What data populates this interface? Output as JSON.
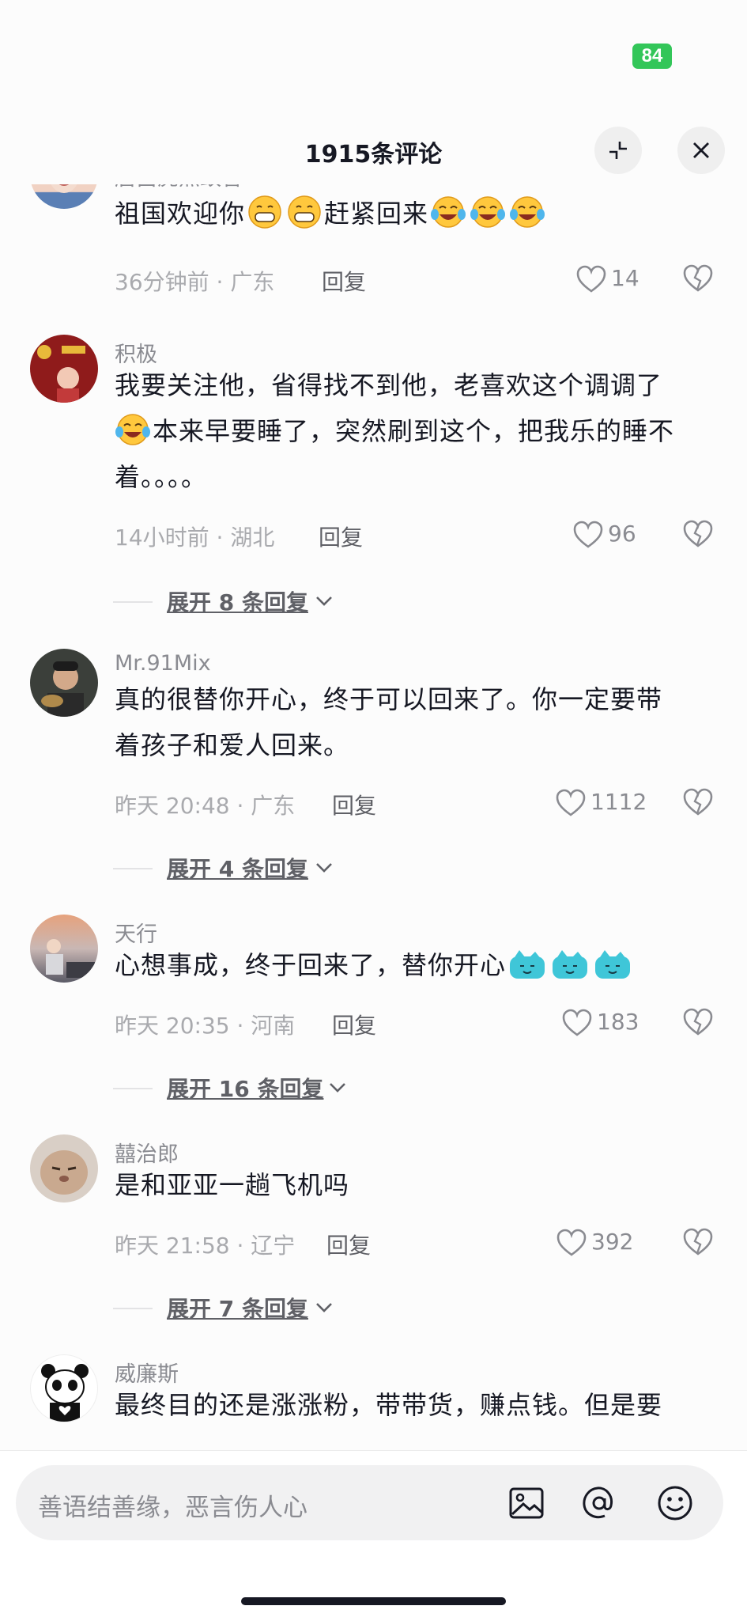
{
  "status_bar": {
    "battery": "84"
  },
  "header": {
    "title": "1915条评论"
  },
  "comments": [
    {
      "username": "唐吕虎点蚊香",
      "text_parts": [
        "祖国欢迎你",
        "赶紧回来"
      ],
      "time_location": "36分钟前 · 广东",
      "reply_label": "回复",
      "likes": "14",
      "expand_label": ""
    },
    {
      "username": "积极",
      "text_line1": "我要关注他，省得找不到他，老喜欢这个调调了",
      "text_line2": "本来早要睡了，突然刷到这个，把我乐的睡不",
      "text_line3": "着。。。。",
      "time_location": "14小时前 · 湖北",
      "reply_label": "回复",
      "likes": "96",
      "expand_label": "展开 8 条回复"
    },
    {
      "username": "Mr.91Mix",
      "text_line1": "真的很替你开心，终于可以回来了。你一定要带",
      "text_line2": "着孩子和爱人回来。",
      "time_location": "昨天 20:48 · 广东",
      "reply_label": "回复",
      "likes": "1112",
      "expand_label": "展开 4 条回复"
    },
    {
      "username": "天行",
      "text_line1": "心想事成，终于回来了，替你开心",
      "time_location": "昨天 20:35 · 河南",
      "reply_label": "回复",
      "likes": "183",
      "expand_label": "展开 16 条回复"
    },
    {
      "username": "囍治郎",
      "text_line1": "是和亚亚一趟飞机吗",
      "time_location": "昨天 21:58 · 辽宁",
      "reply_label": "回复",
      "likes": "392",
      "expand_label": "展开 7 条回复"
    },
    {
      "username": "威廉斯",
      "text_line1": "最终目的还是涨涨粉，带带货，赚点钱。但是要"
    }
  ],
  "input": {
    "placeholder": "善语结善缘，恶言伤人心"
  },
  "icons": {
    "collapse": "collapse-icon",
    "close": "close-icon",
    "like": "heart-icon",
    "dislike": "broken-heart-icon",
    "image": "image-icon",
    "at": "at-icon",
    "emoji": "emoji-icon"
  },
  "colors": {
    "battery": "#33c659",
    "text": "#161823",
    "secondary": "#8a8b91"
  }
}
